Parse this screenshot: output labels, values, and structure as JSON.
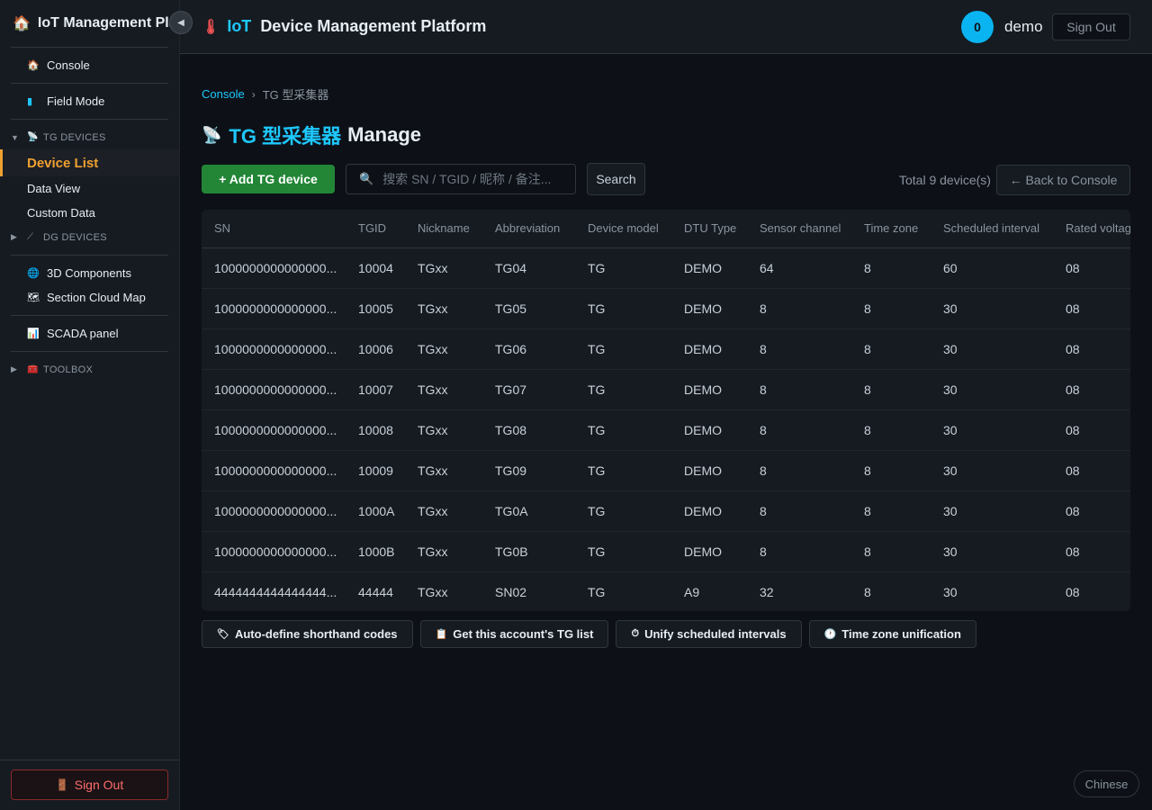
{
  "sidebar": {
    "brand": "IoT Management Platform",
    "brand_icon": "🏠",
    "collapse_icon": "◀",
    "console": {
      "label": "Console",
      "icon": "🏠"
    },
    "field_mode": {
      "label": "Field Mode",
      "icon": "▮"
    },
    "tg_group": {
      "label": "TG DEVICES",
      "caret": "▼",
      "icon": "📡"
    },
    "device_list": "Device List",
    "data_view": "Data View",
    "custom_data": "Custom Data",
    "dg_group": {
      "label": "DG DEVICES",
      "caret": "▶",
      "icon": "⟋"
    },
    "components_3d": {
      "label": "3D Components",
      "icon": "🌐"
    },
    "section_map": {
      "label": "Section Cloud Map",
      "icon": "🗺"
    },
    "scada": {
      "label": "SCADA panel",
      "icon": "📊"
    },
    "toolbox": {
      "label": "TOOLBOX",
      "caret": "▶",
      "icon": "🧰"
    },
    "sign_out": "Sign Out",
    "sign_out_icon": "🚪"
  },
  "header": {
    "icon": "🌡",
    "title_accent": "IoT",
    "title": "Device Management Platform",
    "avatar": "0",
    "username": "demo",
    "sign_out": "Sign Out"
  },
  "breadcrumb": {
    "console": "Console",
    "separator": "›",
    "current": "TG 型采集器"
  },
  "page_title": {
    "icon": "📡",
    "accent": "TG 型采集器",
    "rest": "Manage"
  },
  "toolbar": {
    "add_button": "+ Add TG device",
    "search_icon": "🔍",
    "search_placeholder": "搜索 SN / TGID / 昵称 / 备注...",
    "search_button": "Search",
    "total": "Total 9 device(s)",
    "back_button": "← Back to Console"
  },
  "table": {
    "headers": [
      "SN",
      "TGID",
      "Nickname",
      "Abbreviation",
      "Device model",
      "DTU Type",
      "Sensor channel",
      "Time zone",
      "Scheduled interval",
      "Rated voltage"
    ],
    "rows": [
      [
        "1000000000000000...",
        "10004",
        "TGxx",
        "TG04",
        "TG",
        "DEMO",
        "64",
        "8",
        "60",
        "08"
      ],
      [
        "1000000000000000...",
        "10005",
        "TGxx",
        "TG05",
        "TG",
        "DEMO",
        "8",
        "8",
        "30",
        "08"
      ],
      [
        "1000000000000000...",
        "10006",
        "TGxx",
        "TG06",
        "TG",
        "DEMO",
        "8",
        "8",
        "30",
        "08"
      ],
      [
        "1000000000000000...",
        "10007",
        "TGxx",
        "TG07",
        "TG",
        "DEMO",
        "8",
        "8",
        "30",
        "08"
      ],
      [
        "1000000000000000...",
        "10008",
        "TGxx",
        "TG08",
        "TG",
        "DEMO",
        "8",
        "8",
        "30",
        "08"
      ],
      [
        "1000000000000000...",
        "10009",
        "TGxx",
        "TG09",
        "TG",
        "DEMO",
        "8",
        "8",
        "30",
        "08"
      ],
      [
        "1000000000000000...",
        "1000A",
        "TGxx",
        "TG0A",
        "TG",
        "DEMO",
        "8",
        "8",
        "30",
        "08"
      ],
      [
        "1000000000000000...",
        "1000B",
        "TGxx",
        "TG0B",
        "TG",
        "DEMO",
        "8",
        "8",
        "30",
        "08"
      ],
      [
        "4444444444444444...",
        "44444",
        "TGxx",
        "SN02",
        "TG",
        "A9",
        "32",
        "8",
        "30",
        "08"
      ]
    ]
  },
  "actions": [
    {
      "icon": "🏷",
      "label": "Auto-define shorthand codes"
    },
    {
      "icon": "📋",
      "label": "Get this account's TG list"
    },
    {
      "icon": "⏱",
      "label": "Unify scheduled intervals"
    },
    {
      "icon": "🕐",
      "label": "Time zone unification"
    }
  ],
  "language": "Chinese",
  "colors": {
    "accent": "#1ec8ff",
    "active": "#f0a030",
    "add_button": "#238636",
    "danger": "#ff6b6b",
    "background": "#0d1117"
  }
}
